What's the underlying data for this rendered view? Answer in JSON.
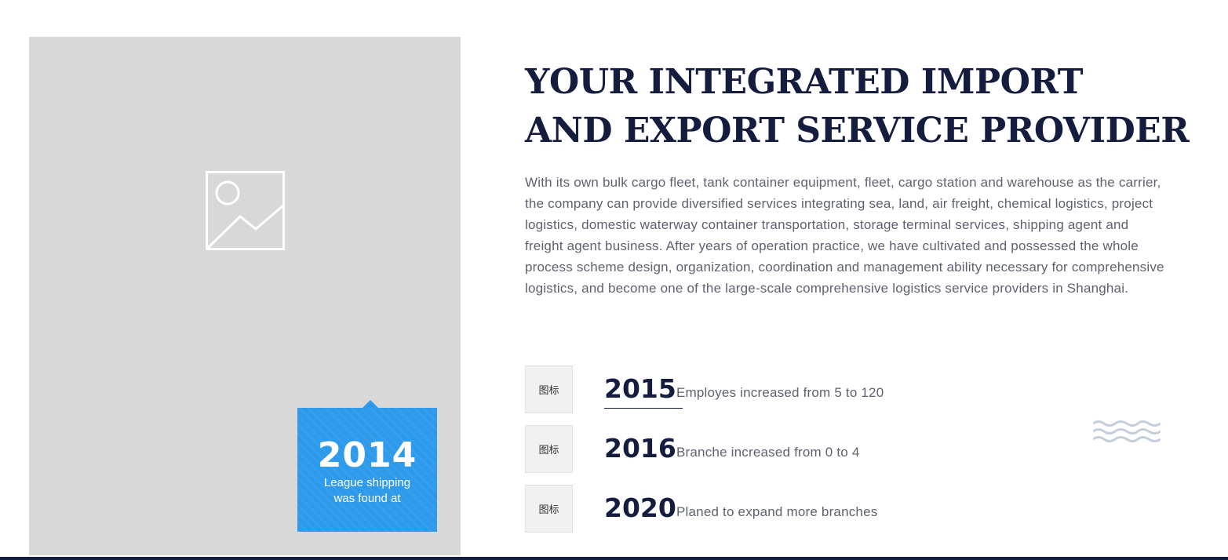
{
  "about": {
    "image_placeholder_icon": "image-placeholder-icon",
    "founded": {
      "year": "2014",
      "line1": "League shipping",
      "line2": "was found at",
      "color": "#2d9aec"
    },
    "headline_line1": "YOUR INTEGRATED IMPORT",
    "headline_line2": "AND EXPORT SERVICE PROVIDER",
    "description": "With its own bulk cargo fleet, tank container equipment, fleet, cargo station and warehouse as the carrier, the company can provide diversified services integrating sea, land, air freight, chemical logistics, project logistics, domestic waterway container transportation, storage terminal services, shipping agent and freight agent business. After years of operation practice, we have cultivated and possessed the whole process scheme design, organization, coordination and management ability necessary for comprehensive logistics, and become one of the large-scale comprehensive logistics service providers in Shanghai.",
    "milestones": [
      {
        "icon_label": "图标",
        "year": "2015",
        "text": "Employes increased from 5 to 120"
      },
      {
        "icon_label": "图标",
        "year": "2016",
        "text": "Branche increased from 0 to 4"
      },
      {
        "icon_label": "图标",
        "year": "2020",
        "text": "Planed to expand more branches"
      }
    ],
    "decoration_icon": "wave-icon",
    "colors": {
      "navy": "#141d3d",
      "accent": "#2d9aec",
      "muted_text": "#5e6270",
      "wave": "#c5cfdc"
    }
  }
}
